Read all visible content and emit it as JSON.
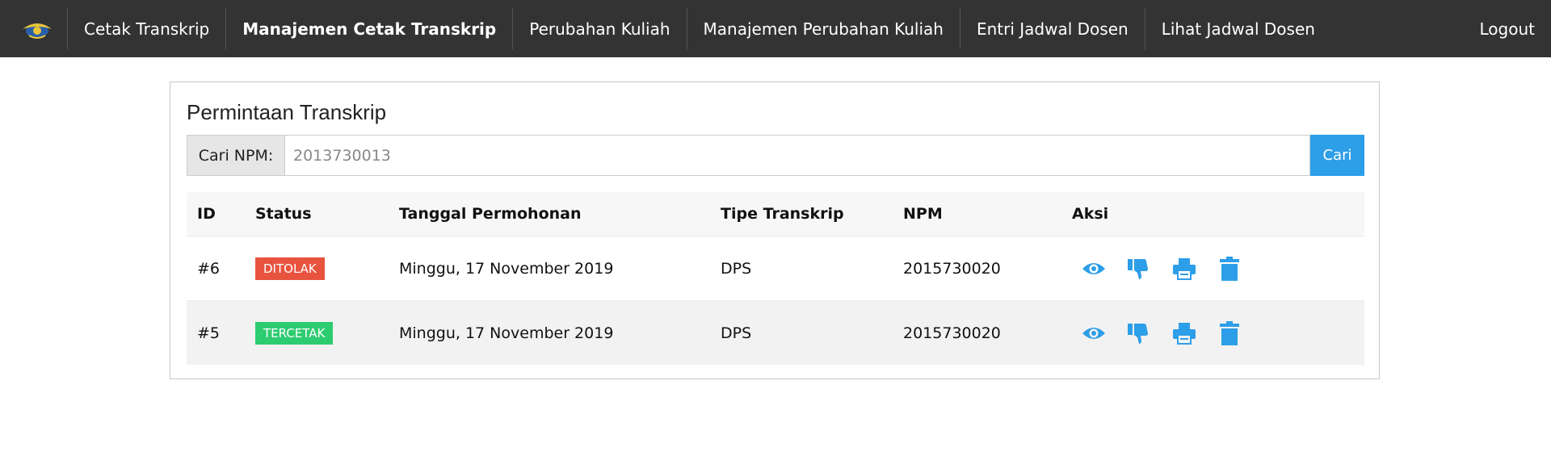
{
  "nav": {
    "items": [
      {
        "label": "Cetak Transkrip",
        "active": false
      },
      {
        "label": "Manajemen Cetak Transkrip",
        "active": true
      },
      {
        "label": "Perubahan Kuliah",
        "active": false
      },
      {
        "label": "Manajemen Perubahan Kuliah",
        "active": false
      },
      {
        "label": "Entri Jadwal Dosen",
        "active": false
      },
      {
        "label": "Lihat Jadwal Dosen",
        "active": false
      }
    ],
    "logout": "Logout"
  },
  "page": {
    "title": "Permintaan Transkrip"
  },
  "search": {
    "label": "Cari NPM:",
    "placeholder": "2013730013",
    "button": "Cari"
  },
  "table": {
    "columns": [
      "ID",
      "Status",
      "Tanggal Permohonan",
      "Tipe Transkrip",
      "NPM",
      "Aksi"
    ],
    "rows": [
      {
        "id": "#6",
        "status": "DITOLAK",
        "date": "Minggu, 17 November 2019",
        "type": "DPS",
        "npm": "2015730020"
      },
      {
        "id": "#5",
        "status": "TERCETAK",
        "date": "Minggu, 17 November 2019",
        "type": "DPS",
        "npm": "2015730020"
      }
    ],
    "action_icons": [
      "eye-icon",
      "thumbs-down-icon",
      "print-icon",
      "trash-icon"
    ]
  },
  "colors": {
    "navbar": "#333333",
    "accent": "#2d9ee8",
    "status_rejected": "#e8533f",
    "status_printed": "#2ecc71"
  }
}
